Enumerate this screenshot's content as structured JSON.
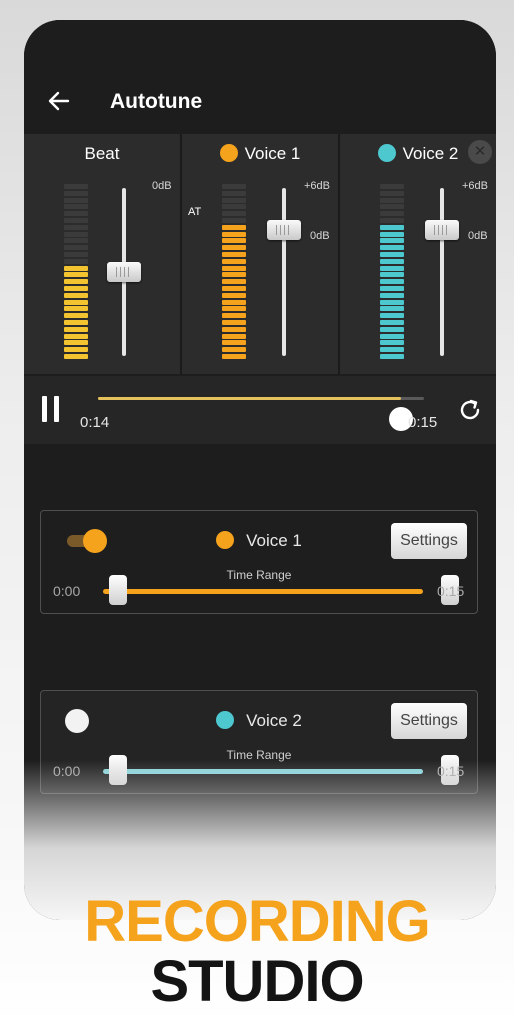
{
  "header": {
    "title": "Autotune"
  },
  "colors": {
    "accent_orange": "#f5a21c",
    "accent_cyan": "#4dc8cf",
    "beat_yellow": "#f4c430",
    "progress": "#e6c25c",
    "promo_orange": "#f5a21c"
  },
  "mixer": {
    "channels": [
      {
        "label": "Beat",
        "dot": false,
        "db_labels": [
          "0dB"
        ],
        "meter_level": 0.52,
        "fader_level": 0.5,
        "color": "#f4c430"
      },
      {
        "label": "Voice 1",
        "dot": true,
        "dot_color": "#f5a21c",
        "db_labels": [
          "+6dB",
          "0dB"
        ],
        "tag": "AT",
        "meter_level": 0.76,
        "fader_level": 0.75,
        "color": "#f5a21c"
      },
      {
        "label": "Voice 2",
        "dot": true,
        "dot_color": "#4dc8cf",
        "db_labels": [
          "+6dB",
          "0dB"
        ],
        "meter_level": 0.76,
        "fader_level": 0.75,
        "color": "#4dc8cf",
        "close_icon": "close-icon"
      }
    ]
  },
  "transport": {
    "time_current": "0:14",
    "time_total": "0:15",
    "progress": 0.93,
    "pause_icon": "pause-icon",
    "loop_icon": "refresh-icon"
  },
  "voices": [
    {
      "name": "Voice 1",
      "enabled": true,
      "settings_label": "Settings",
      "range_label": "Time Range",
      "range_start": "0:00",
      "range_end": "0:15",
      "color": "#f5a21c"
    },
    {
      "name": "Voice 2",
      "enabled": false,
      "settings_label": "Settings",
      "range_label": "Time Range",
      "range_start": "0:00",
      "range_end": "0:15",
      "color": "#4dc8cf"
    }
  ],
  "promo": {
    "line1": "RECORDING",
    "line2": "STUDIO"
  }
}
